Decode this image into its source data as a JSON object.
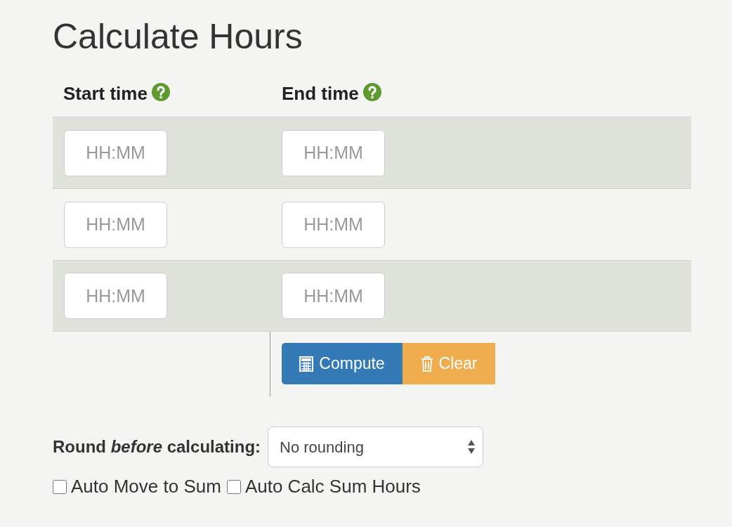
{
  "title": "Calculate Hours",
  "columns": [
    {
      "label": "Start time"
    },
    {
      "label": "End time"
    }
  ],
  "rows": [
    {
      "start": {
        "placeholder": "HH:MM"
      },
      "end": {
        "placeholder": "HH:MM"
      }
    },
    {
      "start": {
        "placeholder": "HH:MM"
      },
      "end": {
        "placeholder": "HH:MM"
      }
    },
    {
      "start": {
        "placeholder": "HH:MM"
      },
      "end": {
        "placeholder": "HH:MM"
      }
    }
  ],
  "buttons": [
    {
      "kind": "compute",
      "label": "Compute"
    },
    {
      "kind": "clear",
      "label": "Clear"
    }
  ],
  "rounding": {
    "label": "Round *before* calculating:",
    "value": "No rounding"
  },
  "options": [
    {
      "label": "Auto Move to Sum",
      "checked": false
    },
    {
      "label": "Auto Calc Sum Hours",
      "checked": false
    }
  ]
}
